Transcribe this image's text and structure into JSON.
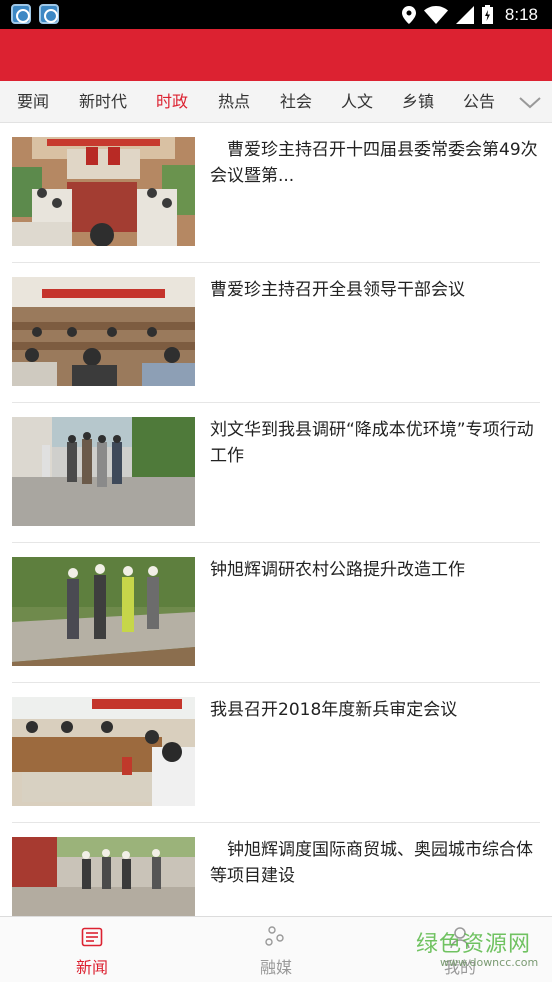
{
  "status_bar": {
    "time": "8:18"
  },
  "colors": {
    "accent": "#dc2231",
    "tab_bar_bg": "#f4f4f4"
  },
  "tabs": [
    {
      "label": "要闻",
      "active": false
    },
    {
      "label": "新时代",
      "active": false
    },
    {
      "label": "时政",
      "active": true
    },
    {
      "label": "热点",
      "active": false
    },
    {
      "label": "社会",
      "active": false
    },
    {
      "label": "人文",
      "active": false
    },
    {
      "label": "乡镇",
      "active": false
    },
    {
      "label": "公告",
      "active": false
    }
  ],
  "news": [
    {
      "title": "　曹爱珍主持召开十四届县委常委会第49次会议暨第...",
      "thumb_icon": "meeting-hall-photo"
    },
    {
      "title": "曹爱珍主持召开全县领导干部会议",
      "thumb_icon": "conference-photo"
    },
    {
      "title": "刘文华到我县调研“降成本优环境”专项行动工作",
      "thumb_icon": "inspection-photo"
    },
    {
      "title": "钟旭辉调研农村公路提升改造工作",
      "thumb_icon": "road-inspection-photo"
    },
    {
      "title": "我县召开2018年度新兵审定会议",
      "thumb_icon": "meeting-table-photo"
    },
    {
      "title": "　钟旭辉调度国际商贸城、奥园城市综合体等项目建设",
      "thumb_icon": "construction-site-photo"
    }
  ],
  "bottom_nav": [
    {
      "label": "新闻",
      "icon": "newspaper-icon",
      "active": true
    },
    {
      "label": "融媒",
      "icon": "media-dots-icon",
      "active": false
    },
    {
      "label": "我的",
      "icon": "user-icon",
      "active": false
    }
  ],
  "watermark": {
    "text": "绿色资源网",
    "url": "www.downcc.com"
  }
}
